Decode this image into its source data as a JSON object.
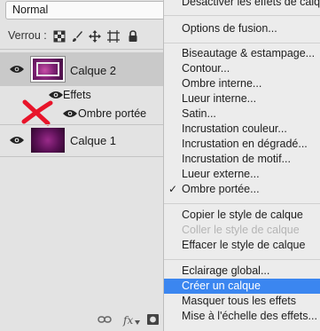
{
  "layers_panel": {
    "blend_mode": "Normal",
    "lock_label": "Verrou :",
    "layers": [
      {
        "name": "Calque 2",
        "selected": true
      },
      {
        "name": "Calque 1",
        "selected": false
      }
    ],
    "effects_label": "Effets",
    "effect_item": "Ombre portée",
    "bottom_fx": "fx"
  },
  "context_menu": {
    "items": [
      {
        "label": "Désactiver les effets de calque",
        "disabled": false
      },
      {
        "label": "Options de fusion...",
        "disabled": false
      },
      {
        "label": "Biseautage & estampage...",
        "disabled": false
      },
      {
        "label": "Contour...",
        "disabled": false
      },
      {
        "label": "Ombre interne...",
        "disabled": false
      },
      {
        "label": "Lueur interne...",
        "disabled": false
      },
      {
        "label": "Satin...",
        "disabled": false
      },
      {
        "label": "Incrustation couleur...",
        "disabled": false
      },
      {
        "label": "Incrustation en dégradé...",
        "disabled": false
      },
      {
        "label": "Incrustation de motif...",
        "disabled": false
      },
      {
        "label": "Lueur externe...",
        "disabled": false
      },
      {
        "label": "Ombre portée...",
        "checked": true
      },
      {
        "label": "Copier le style de calque",
        "disabled": false
      },
      {
        "label": "Coller le style de calque",
        "disabled": true
      },
      {
        "label": "Effacer le style de calque",
        "disabled": false
      },
      {
        "label": "Eclairage global...",
        "disabled": false
      },
      {
        "label": "Créer un calque",
        "highlighted": true
      },
      {
        "label": "Masquer tous les effets",
        "disabled": false
      },
      {
        "label": "Mise à l'échelle des effets...",
        "disabled": false
      }
    ]
  },
  "colors": {
    "highlight": "#3b86f0",
    "annotation_red": "#e8142a",
    "panel_bg": "#e3e3e3",
    "selected_row": "#c9c9c9"
  }
}
